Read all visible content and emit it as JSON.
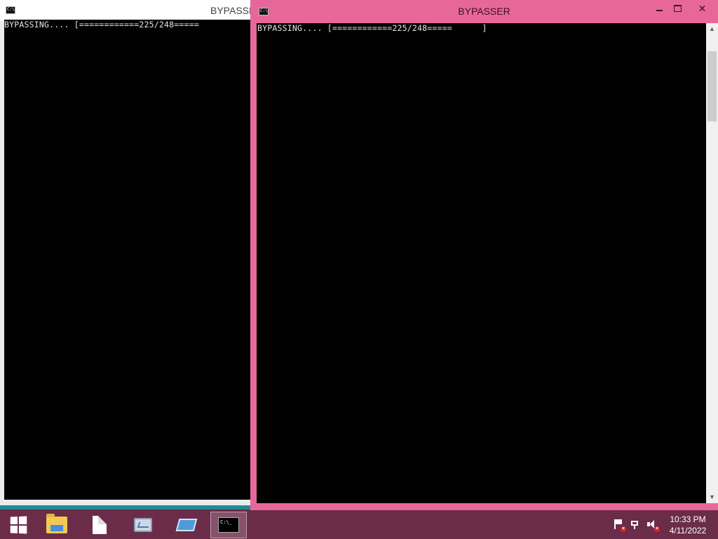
{
  "windows": {
    "back": {
      "title": "BYPASSE",
      "console_line": "BYPASSING.... [============225/248====="
    },
    "front": {
      "title": "BYPASSER",
      "console_line": "BYPASSING.... [============225/248=====      ]",
      "progress": {
        "current": 225,
        "total": 248
      }
    }
  },
  "taskbar": {
    "clock": {
      "time": "10:33 PM",
      "date": "4/11/2022"
    },
    "pinned": [
      "start-icon",
      "file-explorer-icon",
      "document-icon",
      "performance-monitor-icon",
      "remote-desktop-icon",
      "command-prompt-icon"
    ]
  },
  "colors": {
    "active_frame": "#e8679b",
    "taskbar": "#6b2c4a",
    "console_bg": "#000000",
    "console_text": "#e6e6e6"
  }
}
